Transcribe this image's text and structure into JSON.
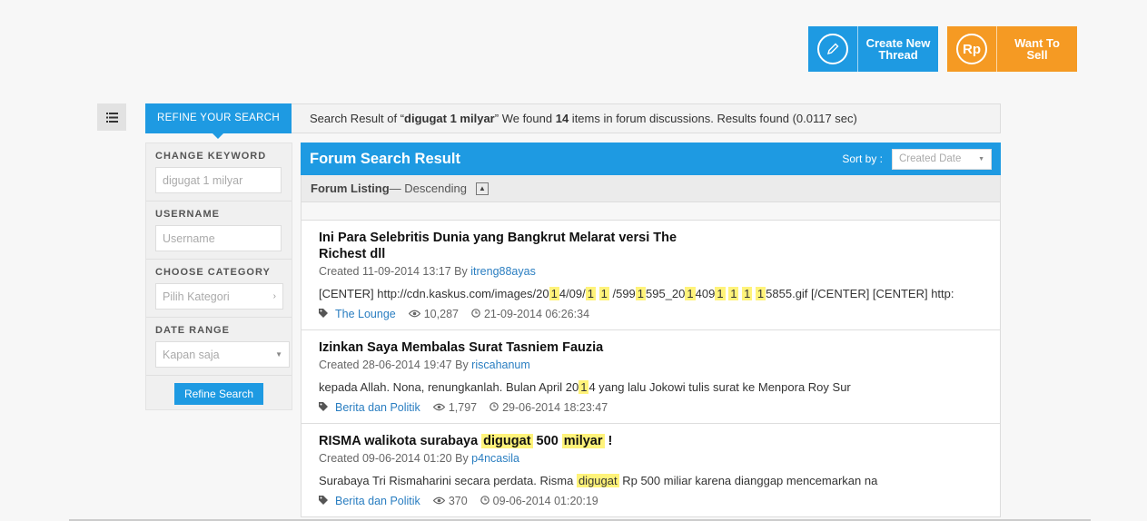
{
  "top_actions": {
    "create_thread": "Create New Thread",
    "want_to_sell": "Want To Sell",
    "sell_icon_text": "Rp"
  },
  "search_bar": {
    "refine_tab": "REFINE YOUR SEARCH",
    "summary_prefix": "Search Result of “",
    "query": "digugat 1 milyar",
    "summary_mid": "” We found ",
    "count": "14",
    "summary_suffix": " items in forum discussions. Results found (0.0117 sec)"
  },
  "filters": {
    "keyword_label": "CHANGE KEYWORD",
    "keyword_value": "digugat 1 milyar",
    "username_label": "USERNAME",
    "username_placeholder": "Username",
    "category_label": "CHOOSE CATEGORY",
    "category_value": "Pilih Kategori",
    "date_label": "DATE RANGE",
    "date_value": "Kapan saja",
    "refine_button": "Refine Search"
  },
  "results": {
    "title": "Forum Search Result",
    "sort_label": "Sort by :",
    "sort_value": "Created Date",
    "listing_label": "Forum Listing",
    "listing_order": " — Descending"
  },
  "items": [
    {
      "title": "Ini Para Selebritis Dunia yang Bangkrut Melarat versi The Richest dll",
      "created": "Created 11-09-2014 13:17 By ",
      "author": "itreng88ayas",
      "snippet_html": "[CENTER] http://cdn.kaskus.com/images/20<mark>1</mark>4/09/<mark>1</mark> <mark>1</mark> /599<mark>1</mark>595_20<mark>1</mark>409<mark>1</mark> <mark>1</mark> <mark>1</mark> <mark>1</mark>5855.gif [/CENTER] [CENTER] http:",
      "category": "The Lounge",
      "views": "10,287",
      "last": "21-09-2014 06:26:34"
    },
    {
      "title": "Izinkan Saya Membalas Surat Tasniem Fauzia",
      "created": "Created 28-06-2014 19:47 By ",
      "author": "riscahanum",
      "snippet_html": "kepada Allah. Nona, renungkanlah. Bulan April 20<mark>1</mark>4 yang lalu Jokowi tulis surat ke Menpora Roy Sur",
      "category": "Berita dan Politik",
      "views": "1,797",
      "last": "29-06-2014 18:23:47"
    },
    {
      "title": "RISMA walikota surabaya <mark>digugat</mark> 500 <mark>milyar</mark> !",
      "created": "Created 09-06-2014 01:20 By ",
      "author": "p4ncasila",
      "snippet_html": "Surabaya Tri Rismaharini secara perdata. Risma <mark>digugat</mark> Rp 500 miliar karena dianggap mencemarkan na",
      "category": "Berita dan Politik",
      "views": "370",
      "last": "09-06-2014 01:20:19"
    }
  ]
}
